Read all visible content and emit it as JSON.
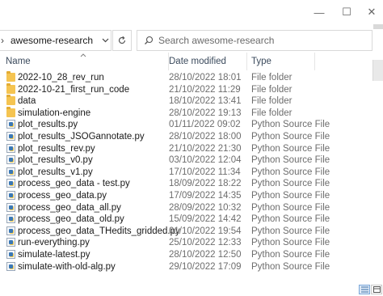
{
  "window": {
    "minimize_glyph": "—",
    "maximize_glyph": "☐",
    "close_glyph": "✕"
  },
  "address": {
    "current_folder": "awesome-research",
    "chevron": "›"
  },
  "search": {
    "placeholder": "Search awesome-research"
  },
  "columns": {
    "name": "Name",
    "date": "Date modified",
    "type": "Type"
  },
  "files": [
    {
      "name": "2022-10_28_rev_run",
      "date": "28/10/2022 18:01",
      "type": "File folder",
      "icon": "folder-icon"
    },
    {
      "name": "2022-10-21_first_run_code",
      "date": "21/10/2022 11:29",
      "type": "File folder",
      "icon": "folder-icon"
    },
    {
      "name": "data",
      "date": "18/10/2022 13:41",
      "type": "File folder",
      "icon": "folder-icon"
    },
    {
      "name": "simulation-engine",
      "date": "28/10/2022 19:13",
      "type": "File folder",
      "icon": "folder-icon"
    },
    {
      "name": "plot_results.py",
      "date": "01/11/2022 09:02",
      "type": "Python Source File",
      "icon": "python-file-icon"
    },
    {
      "name": "plot_results_JSOGannotate.py",
      "date": "28/10/2022 18:00",
      "type": "Python Source File",
      "icon": "python-file-icon"
    },
    {
      "name": "plot_results_rev.py",
      "date": "21/10/2022 21:30",
      "type": "Python Source File",
      "icon": "python-file-icon"
    },
    {
      "name": "plot_results_v0.py",
      "date": "03/10/2022 12:04",
      "type": "Python Source File",
      "icon": "python-file-icon"
    },
    {
      "name": "plot_results_v1.py",
      "date": "17/10/2022 11:34",
      "type": "Python Source File",
      "icon": "python-file-icon"
    },
    {
      "name": "process_geo_data - test.py",
      "date": "18/09/2022 18:22",
      "type": "Python Source File",
      "icon": "python-file-icon"
    },
    {
      "name": "process_geo_data.py",
      "date": "17/09/2022 14:35",
      "type": "Python Source File",
      "icon": "python-file-icon"
    },
    {
      "name": "process_geo_data_all.py",
      "date": "28/09/2022 10:32",
      "type": "Python Source File",
      "icon": "python-file-icon"
    },
    {
      "name": "process_geo_data_old.py",
      "date": "15/09/2022 14:42",
      "type": "Python Source File",
      "icon": "python-file-icon"
    },
    {
      "name": "process_geo_data_THedits_gridded.py",
      "date": "01/10/2022 19:54",
      "type": "Python Source File",
      "icon": "python-file-icon"
    },
    {
      "name": "run-everything.py",
      "date": "25/10/2022 12:33",
      "type": "Python Source File",
      "icon": "python-file-icon"
    },
    {
      "name": "simulate-latest.py",
      "date": "28/10/2022 12:50",
      "type": "Python Source File",
      "icon": "python-file-icon"
    },
    {
      "name": "simulate-with-old-alg.py",
      "date": "29/10/2022 17:09",
      "type": "Python Source File",
      "icon": "python-file-icon"
    }
  ],
  "colors": {
    "folder": "#f5c451",
    "header_text": "#3b4a5c",
    "secondary_text": "#6d6d6d",
    "active_view": "#dde9f7"
  }
}
